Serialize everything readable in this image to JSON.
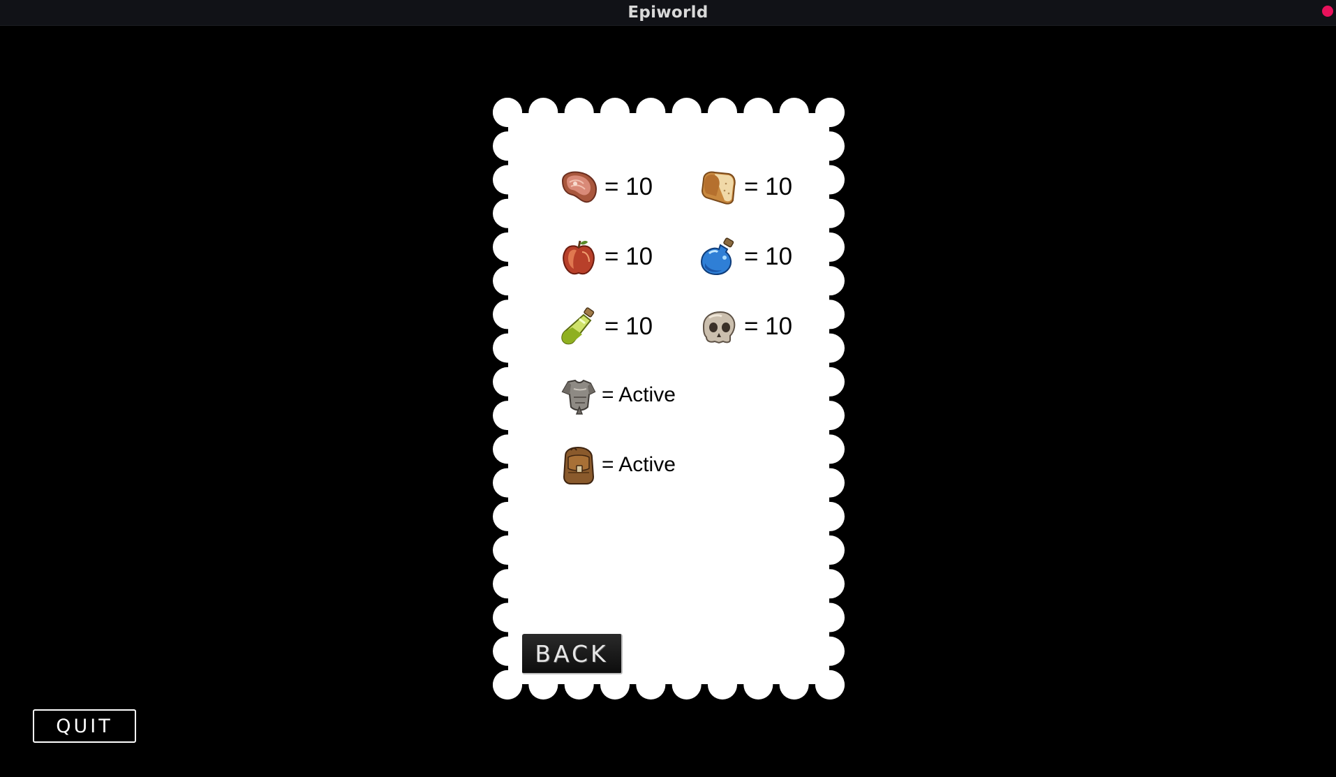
{
  "window": {
    "title": "Epiworld",
    "close_color": "#e8115b"
  },
  "inventory": {
    "meat": {
      "icon": "meat-icon",
      "text": "= 10"
    },
    "bread": {
      "icon": "bread-icon",
      "text": "= 10"
    },
    "apple": {
      "icon": "apple-icon",
      "text": "= 10"
    },
    "blue_potion": {
      "icon": "blue-potion-icon",
      "text": "= 10"
    },
    "green_potion": {
      "icon": "green-potion-icon",
      "text": "= 10"
    },
    "skull": {
      "icon": "skull-icon",
      "text": "= 10"
    },
    "armor": {
      "icon": "armor-icon",
      "text": "= Active"
    },
    "backpack": {
      "icon": "backpack-icon",
      "text": "= Active"
    }
  },
  "buttons": {
    "back_label": "BACK",
    "quit_label": "QUIT"
  },
  "colors": {
    "background": "#000000",
    "panel": "#ffffff",
    "titlebar": "#111217"
  }
}
